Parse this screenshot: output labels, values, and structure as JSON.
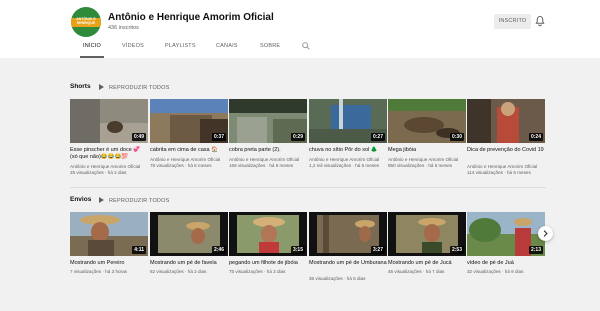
{
  "channel": {
    "avatar_text": "ANTÔNIO E HENRIQUE",
    "name": "Antônio e Henrique Amorim Oficial",
    "subscribers": "436 inscritos",
    "subscribe_label": "INSCRITO"
  },
  "tabs": [
    "INÍCIO",
    "VÍDEOS",
    "PLAYLISTS",
    "CANAIS",
    "SOBRE"
  ],
  "shorts": {
    "title": "Shorts",
    "play_all": "REPRODUZIR TODOS",
    "items": [
      {
        "title": "Esse pinscher é um doce 💞 (só que não)😂😂😂💯",
        "channel": "Antônio e Henrique Amorim Oficial",
        "meta": "25 visualizações · há 2 dias",
        "duration": "0:49"
      },
      {
        "title": "cabrita em cima de casa 🏠",
        "channel": "Antônio e Henrique Amorim Oficial",
        "meta": "78 visualizações · há 6 meses",
        "duration": "0:37"
      },
      {
        "title": "cobra preta parte (2).",
        "channel": "Antônio e Henrique Amorim Oficial",
        "meta": "169 visualizações · há 6 meses",
        "duration": "0:29"
      },
      {
        "title": "chuva no sítio Pôr do sol 🌲",
        "channel": "Antônio e Henrique Amorim Oficial",
        "meta": "1,2 mil visualizações · há 6 meses",
        "duration": "0:27"
      },
      {
        "title": "Mega jibóia",
        "channel": "Antônio e Henrique Amorim Oficial",
        "meta": "950 visualizações · há 6 meses",
        "duration": "0:30"
      },
      {
        "title": "Dica de prevenção do Covid 19",
        "channel": "Antônio e Henrique Amorim Oficial",
        "meta": "114 visualizações · há 6 meses",
        "duration": "0:24"
      }
    ]
  },
  "uploads": {
    "title": "Envios",
    "play_all": "REPRODUZIR TODOS",
    "items": [
      {
        "title": "Mostrando um Pereiro",
        "meta": "7 visualizações · há 3 horas",
        "duration": "4:11"
      },
      {
        "title": "Mostrando um pé de favela",
        "meta": "62 visualizações · há 2 dias",
        "duration": "2:46"
      },
      {
        "title": "pegando um filhote de jibóia",
        "meta": "75 visualizações · há 3 dias",
        "duration": "3:15"
      },
      {
        "title": "Mostrando um pé de Umburana",
        "meta": "36 visualizações · há 5 dias",
        "duration": "3:27"
      },
      {
        "title": "Mostrando um pé de Jucá",
        "meta": "45 visualizações · há 7 dias",
        "duration": "2:53"
      },
      {
        "title": "vídeo de pé de Juá",
        "meta": "32 visualizações · há 9 dias",
        "duration": "2:13"
      }
    ]
  }
}
